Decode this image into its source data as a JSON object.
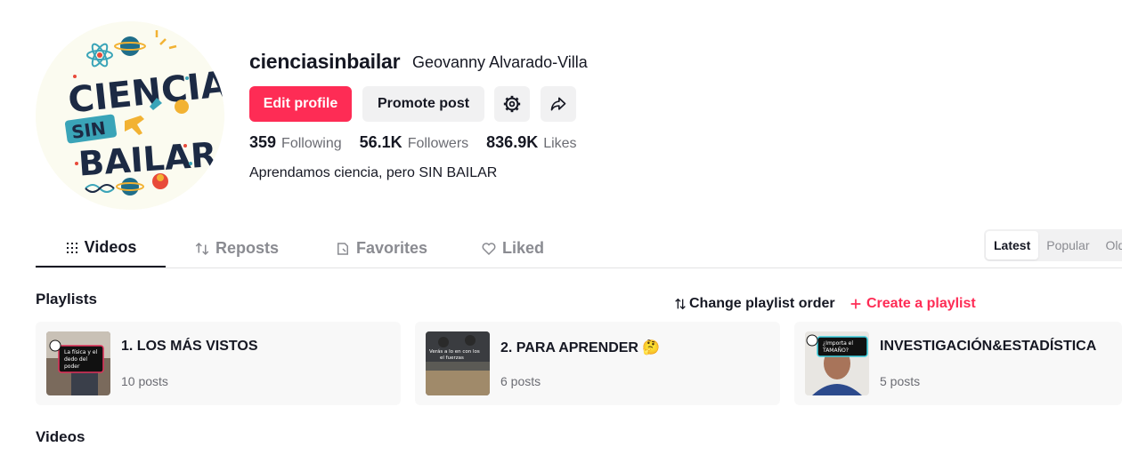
{
  "profile": {
    "username": "cienciasinbailar",
    "nickname": "Geovanny Alvarado-Villa",
    "bio": "Aprendamos ciencia, pero SIN BAILAR",
    "avatar_lettering": "CIENCIA SIN BAILAR"
  },
  "actions": {
    "edit_label": "Edit profile",
    "promote_label": "Promote post",
    "settings_icon": "gear-icon",
    "share_icon": "share-icon"
  },
  "stats": {
    "following_count": "359",
    "following_label": "Following",
    "followers_count": "56.1K",
    "followers_label": "Followers",
    "likes_count": "836.9K",
    "likes_label": "Likes"
  },
  "tabs": [
    {
      "label": "Videos",
      "icon": "grid-icon",
      "active": true
    },
    {
      "label": "Reposts",
      "icon": "repost-icon"
    },
    {
      "label": "Favorites",
      "icon": "bookmark-icon"
    },
    {
      "label": "Liked",
      "icon": "heart-icon"
    }
  ],
  "sort": {
    "options": [
      "Latest",
      "Popular",
      "Oldest"
    ],
    "selected": "Latest"
  },
  "playlists": {
    "title": "Playlists",
    "change_order_label": "Change playlist order",
    "create_label": "Create a playlist",
    "items": [
      {
        "name": "1. LOS MÁS VISTOS",
        "count": "10 posts",
        "thumb_caption": "La física y el dedo del poder"
      },
      {
        "name": "2. PARA APRENDER 🤔",
        "count": "6 posts",
        "thumb_caption": "Verás a lo en con los el fuerzas"
      },
      {
        "name": "INVESTIGACIÓN&ESTADÍSTICA",
        "count": "5 posts",
        "thumb_caption": "¿Importa el TAMAÑO?"
      }
    ]
  },
  "videos": {
    "title": "Videos"
  },
  "colors": {
    "accent": "#fe2c55",
    "text": "#161823",
    "muted": "#6b6c73",
    "button_bg": "#f1f1f2"
  }
}
